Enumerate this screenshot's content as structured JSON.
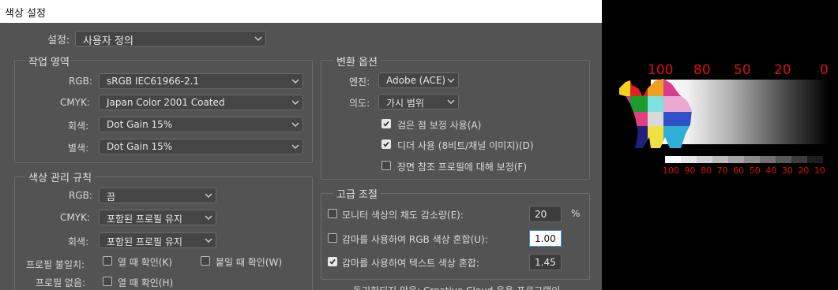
{
  "window": {
    "title": "색상 설정"
  },
  "settings": {
    "label": "설정:",
    "value": "사용자 정의"
  },
  "workspace": {
    "title": "작업 영역",
    "rgb": {
      "label": "RGB:",
      "value": "sRGB IEC61966-2.1"
    },
    "cmyk": {
      "label": "CMYK:",
      "value": "Japan Color 2001 Coated"
    },
    "gray": {
      "label": "회색:",
      "value": "Dot Gain 15%"
    },
    "spot": {
      "label": "별색:",
      "value": "Dot Gain 15%"
    }
  },
  "policies": {
    "title": "색상 관리 규칙",
    "rgb": {
      "label": "RGB:",
      "value": "끔"
    },
    "cmyk": {
      "label": "CMYK:",
      "value": "포함된 프로필 유지"
    },
    "gray": {
      "label": "회색:",
      "value": "포함된 프로필 유지"
    },
    "mismatch": {
      "label": "프로필 불일치:",
      "open": "열 때 확인(K)",
      "paste": "붙일 때 확인(W)"
    },
    "missing": {
      "label": "프로필 없음:",
      "open": "열 때 확인(H)"
    }
  },
  "conversion": {
    "title": "변환 옵션",
    "engine": {
      "label": "엔진:",
      "value": "Adobe (ACE)"
    },
    "intent": {
      "label": "의도:",
      "value": "가시 범위"
    },
    "black_point": {
      "label": "검은 점 보정 사용(A)",
      "checked": true
    },
    "dither": {
      "label": "디더 사용 (8비트/채널 이미지)(D)",
      "checked": true
    },
    "scene_ref": {
      "label": "장면 참조 프로필에 대해 보정(F)",
      "checked": false
    }
  },
  "advanced": {
    "title": "고급 조절",
    "desaturate": {
      "label": "모니터 색상의 채도 감소량(E):",
      "value": "20",
      "unit": "%",
      "checked": false
    },
    "blend_rgb": {
      "label": "감마를 사용하여 RGB 색상 혼합(U):",
      "value": "1.00",
      "checked": false
    },
    "blend_text": {
      "label": "감마를 사용하여 텍스트 색상 혼합:",
      "value": "1.45",
      "checked": true
    },
    "footer_partial": "동기화되지 않음: Creative Cloud 응용 프로그램이"
  },
  "preview": {
    "top_scale": [
      "100",
      "80",
      "50",
      "20",
      "0"
    ],
    "bottom_scale": [
      "100",
      "90",
      "80",
      "70",
      "60",
      "50",
      "40",
      "30",
      "20",
      "10"
    ],
    "label_color": "#e01010"
  }
}
